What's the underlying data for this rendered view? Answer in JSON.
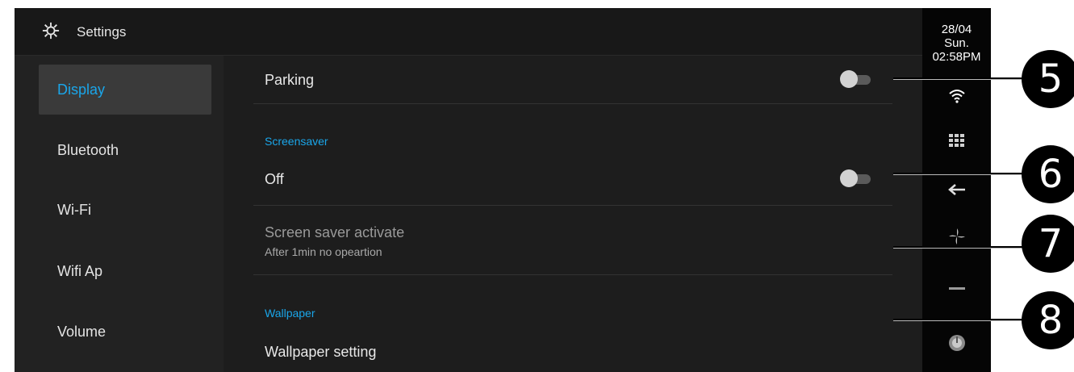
{
  "header": {
    "title": "Settings",
    "icon": "gear-icon"
  },
  "sidebar": {
    "items": [
      {
        "label": "Display",
        "active": true
      },
      {
        "label": "Bluetooth"
      },
      {
        "label": "Wi-Fi"
      },
      {
        "label": "Wifi Ap"
      },
      {
        "label": "Volume"
      }
    ]
  },
  "content": {
    "parking": {
      "label": "Parking",
      "toggle": "off"
    },
    "screensaver": {
      "section": "Screensaver",
      "state_label": "Off",
      "toggle": "off",
      "activate_title": "Screen saver activate",
      "activate_sub": "After 1min no opeartion"
    },
    "wallpaper": {
      "section": "Wallpaper",
      "setting_label": "Wallpaper setting"
    }
  },
  "status": {
    "date": "28/04",
    "day": "Sun.",
    "time": "02:58PM"
  },
  "right_icons": [
    "wifi-icon",
    "grid-icon",
    "back-icon",
    "fan-icon",
    "minus-icon",
    "power-knob-icon"
  ],
  "callouts": [
    "5",
    "6",
    "7",
    "8"
  ],
  "colors": {
    "accent": "#1aa6ea",
    "background": "#1d1d1d",
    "sidebar_active": "#3a3a3a"
  }
}
